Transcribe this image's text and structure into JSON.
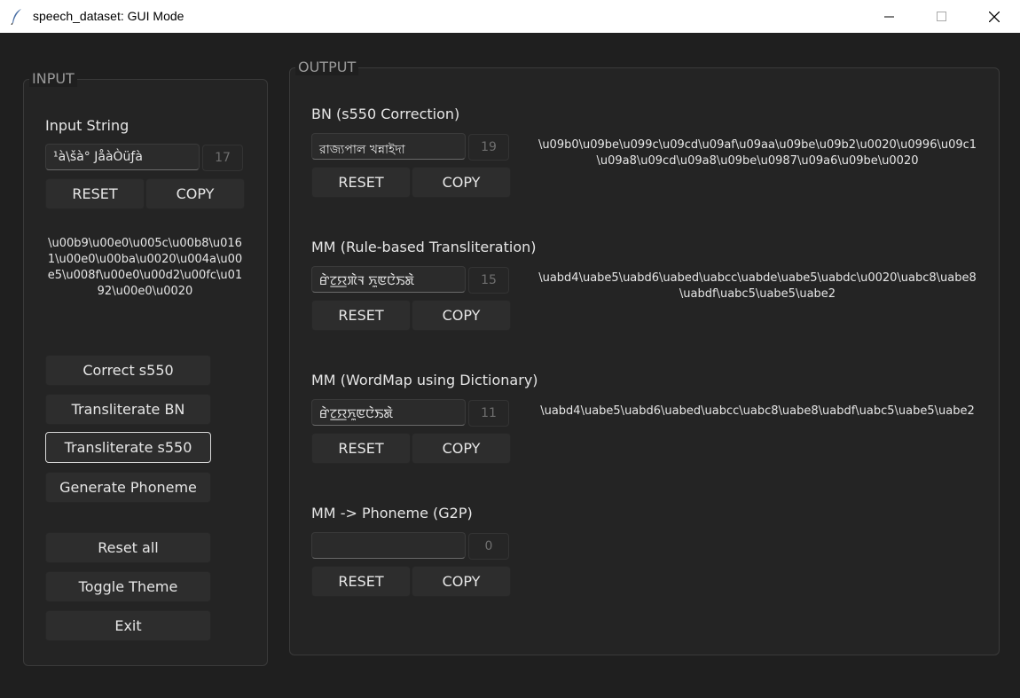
{
  "window": {
    "title": "speech_dataset: GUI Mode",
    "icons": {
      "app": "feather-icon",
      "minimize": "minimize-icon",
      "maximize": "maximize-icon",
      "close": "close-icon"
    }
  },
  "input": {
    "frame_label": "INPUT",
    "field_label": "Input String",
    "value": "¹à\\šà° JåàÒüƒà",
    "count": "17",
    "reset_label": "RESET",
    "copy_label": "COPY",
    "unicode_text": "\\u00b9\\u00e0\\u005c\\u00b8\\u0161\\u00e0\\u00ba\\u0020\\u004a\\u00e5\\u008f\\u00e0\\u00d2\\u00fc\\u0192\\u00e0\\u0020",
    "actions": [
      "Correct s550",
      "Transliterate BN",
      "Transliterate s550",
      "Generate Phoneme"
    ],
    "utilities": [
      "Reset all",
      "Toggle Theme",
      "Exit"
    ]
  },
  "output": {
    "frame_label": "OUTPUT",
    "sections": [
      {
        "label": "BN (s550 Correction)",
        "value": "রাজ্যপাল খন্নাইদা",
        "count": "19",
        "unicode": "\\u09b0\\u09be\\u099c\\u09cd\\u09af\\u09aa\\u09be\\u09b2\\u0020\\u0996\\u09c1\\u09a8\\u09cd\\u09a8\\u09be\\u0987\\u09a6\\u09be\\u0020"
      },
      {
        "label": "MM (Rule-based Transliteration)",
        "value": "ꯔꯥꯖ꯭ꯌꯞꯥꯜ ꯈꯨꯟꯅꯥꯏꯗꯥ",
        "count": "15",
        "unicode": "\\uabd4\\uabe5\\uabd6\\uabed\\uabcc\\uabde\\uabe5\\uabdc\\u0020\\uabc8\\uabe8\\uabdf\\uabc5\\uabe5\\uabe2"
      },
      {
        "label": "MM (WordMap using Dictionary)",
        "value": "ꯔꯥꯖ꯭ꯌꯈꯨꯟꯅꯥꯏꯗꯥ",
        "count": "11",
        "unicode": "\\uabd4\\uabe5\\uabd6\\uabed\\uabcc\\uabc8\\uabe8\\uabdf\\uabc5\\uabe5\\uabe2"
      },
      {
        "label": "MM -> Phoneme (G2P)",
        "value": "",
        "count": "0",
        "unicode": ""
      }
    ],
    "reset_label": "RESET",
    "copy_label": "COPY"
  },
  "colors": {
    "background": "#1f1f1f",
    "panel": "#242424",
    "button": "#2d2d2d",
    "titlebar": "#ffffff"
  }
}
